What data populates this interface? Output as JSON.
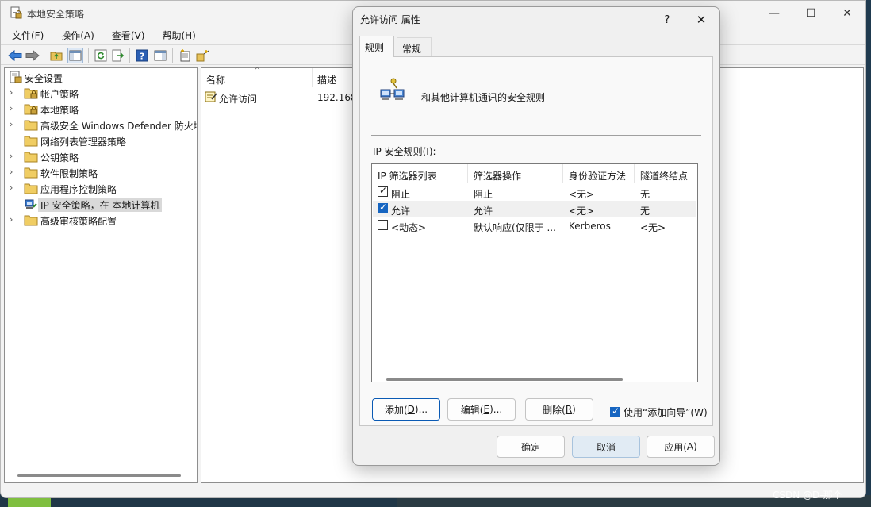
{
  "main_window": {
    "title": "本地安全策略",
    "controls": {
      "minimize": "—",
      "maximize": "☐",
      "close": "✕"
    }
  },
  "menu": [
    "文件(F)",
    "操作(A)",
    "查看(V)",
    "帮助(H)"
  ],
  "tree": {
    "root": "安全设置",
    "items": [
      {
        "label": "帐户策略",
        "expandable": true,
        "icon": "folder-lock-icon"
      },
      {
        "label": "本地策略",
        "expandable": true,
        "icon": "folder-lock-icon"
      },
      {
        "label": "高级安全 Windows Defender 防火墙",
        "expandable": true,
        "icon": "folder-icon"
      },
      {
        "label": "网络列表管理器策略",
        "expandable": false,
        "icon": "folder-icon"
      },
      {
        "label": "公钥策略",
        "expandable": true,
        "icon": "folder-icon"
      },
      {
        "label": "软件限制策略",
        "expandable": true,
        "icon": "folder-icon"
      },
      {
        "label": "应用程序控制策略",
        "expandable": true,
        "icon": "folder-icon"
      },
      {
        "label": "IP 安全策略，在 本地计算机",
        "expandable": false,
        "icon": "ip-security-icon",
        "selected": true
      },
      {
        "label": "高级审核策略配置",
        "expandable": true,
        "icon": "folder-icon"
      }
    ]
  },
  "list": {
    "columns": [
      "名称",
      "描述"
    ],
    "rows": [
      {
        "name": "允许访问",
        "desc": "192.168"
      }
    ]
  },
  "dialog": {
    "title": "允许访问 属性",
    "help": "?",
    "close": "✕",
    "tabs": [
      "规则",
      "常规"
    ],
    "description": "和其他计算机通讯的安全规则",
    "rules_label_pre": "IP 安全规则(",
    "rules_label_key": "I",
    "rules_label_post": "):",
    "rules_columns": [
      "IP 筛选器列表",
      "筛选器操作",
      "身份验证方法",
      "隧道终结点"
    ],
    "rules": [
      {
        "checked": true,
        "filter_list": "阻止",
        "action": "阻止",
        "auth": "<无>",
        "tunnel": "无"
      },
      {
        "checked": true,
        "filter_list": "允许",
        "action": "允许",
        "auth": "<无>",
        "tunnel": "无"
      },
      {
        "checked": false,
        "filter_list": "<动态>",
        "action": "默认响应(仅限于 ...",
        "auth": "Kerberos",
        "tunnel": "<无>"
      }
    ],
    "buttons": {
      "add": {
        "pre": "添加(",
        "key": "D",
        "post": ")..."
      },
      "edit": {
        "pre": "编辑(",
        "key": "E",
        "post": ")..."
      },
      "remove": {
        "pre": "删除(",
        "key": "R",
        "post": ")"
      },
      "ok": "确定",
      "cancel": "取消",
      "apply": {
        "pre": "应用(",
        "key": "A",
        "post": ")"
      }
    },
    "wizard": {
      "checked": true,
      "pre": "使用“添加向导”(",
      "key": "W",
      "post": ")"
    }
  },
  "watermark": "CSDN @D-那个"
}
